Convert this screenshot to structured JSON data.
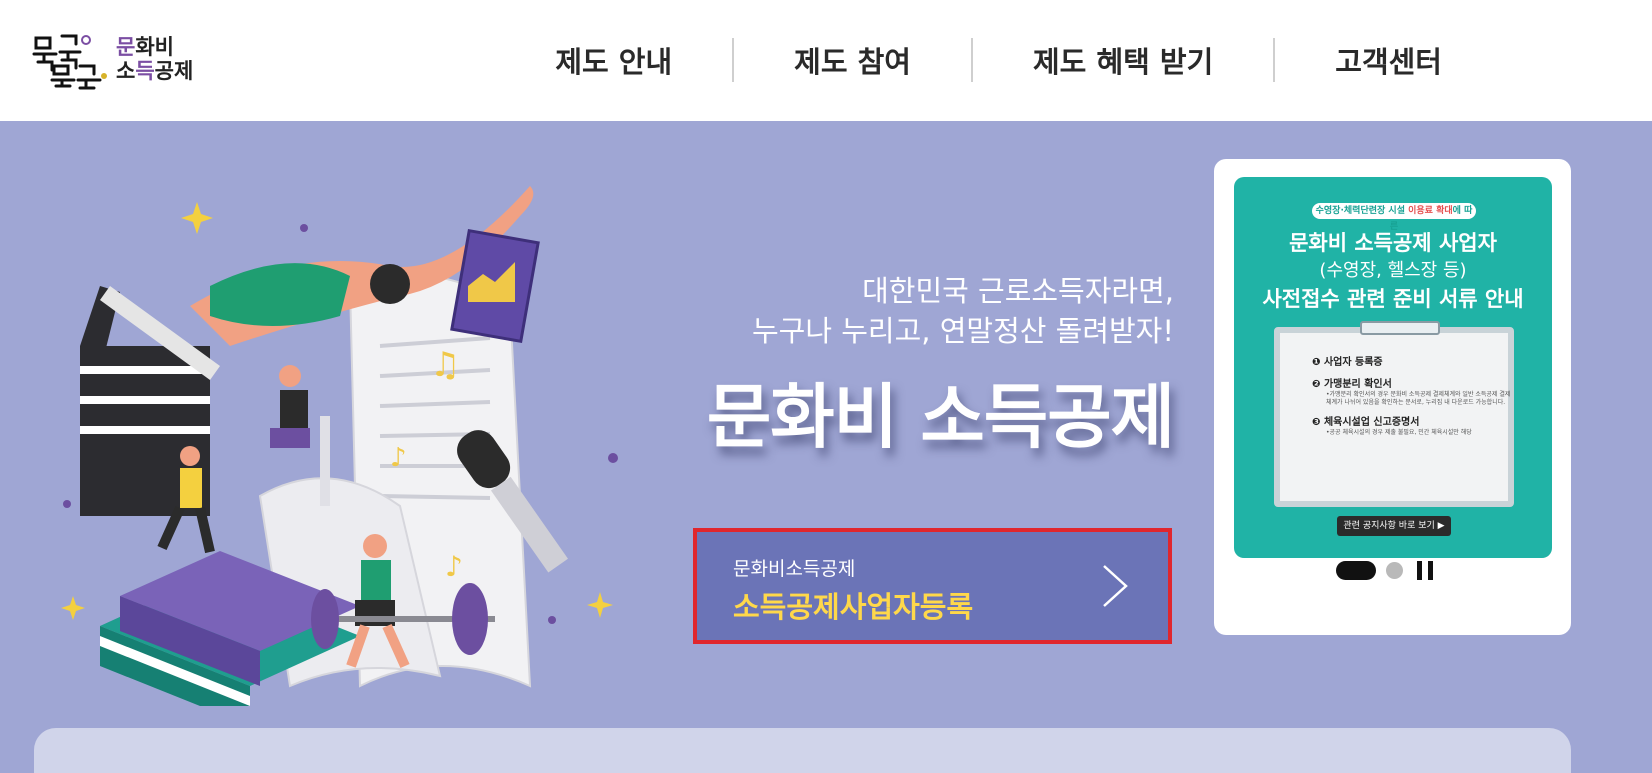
{
  "logo": {
    "script_alt": "문득 문득",
    "line1_prefix": "문",
    "line1_rest": "화비",
    "line2_prefix": "소",
    "line2_accent": "득",
    "line2_rest": "공제"
  },
  "nav": {
    "items": [
      {
        "label": "제도 안내"
      },
      {
        "label": "제도 참여"
      },
      {
        "label": "제도 혜택 받기"
      },
      {
        "label": "고객센터"
      }
    ]
  },
  "hero": {
    "tagline_line1": "대한민국 근로소득자라면,",
    "tagline_line2": "누구나 누리고, 연말정산 돌려받자!",
    "title": "문화비 소득공제",
    "cta": {
      "sub_label": "문화비소득공제",
      "main_label": "소득공제사업자등록"
    }
  },
  "banner": {
    "pill_prefix": "수영장·체력단련장 시설 ",
    "pill_highlight": "이용료 확대",
    "pill_suffix": "에 따른",
    "title_line1": "문화비 소득공제 사업자",
    "title_line2": "(수영장, 헬스장 등)",
    "title_line3": "사전접수 관련 준비 서류 안내",
    "items": [
      {
        "heading": "❶ 사업자 등록증",
        "desc": ""
      },
      {
        "heading": "❷ 가맹분리 확인서",
        "desc": "•가맹분리 확인서의 경우 문화비 소득공제 결제체계와 일반 소득공제 결제 체계가 나뉘어 있음을 확인하는 문서로, 누리집 내 다운로드 가능합니다."
      },
      {
        "heading": "❸ 체육시설업 신고증명서",
        "desc": "•공공 체육시설의 경우 제출 불필요, 민간 체육시설만 해당"
      }
    ],
    "button_label": "관련 공지사항 바로 보기 ▶"
  },
  "colors": {
    "hero_bg": "#9fa6d4",
    "cta_bg": "#6b74b7",
    "cta_border": "#e0262d",
    "cta_highlight": "#ffd84a",
    "banner_bg": "#20b3a6",
    "logo_accent": "#7b4ea3"
  },
  "icons": {
    "cta_arrow": "chevron-right-icon",
    "pause": "pause-icon"
  }
}
